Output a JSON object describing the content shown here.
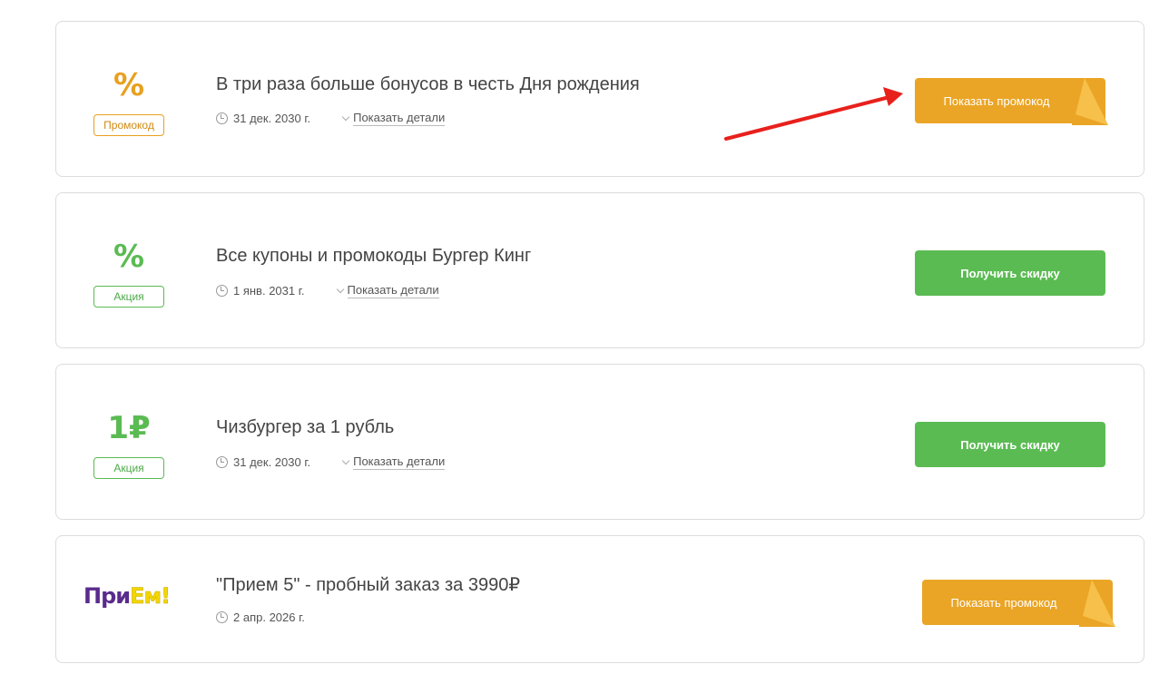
{
  "offers": [
    {
      "sign": "%",
      "tag": "Промокод",
      "title": "В три раза больше бонусов в честь Дня рождения",
      "date": "31 дек. 2030 г.",
      "details": "Показать детали",
      "button": "Показать промокод"
    },
    {
      "sign": "%",
      "tag": "Акция",
      "title": "Все купоны и промокоды Бургер Кинг",
      "date": "1 янв. 2031 г.",
      "details": "Показать детали",
      "button": "Получить скидку"
    },
    {
      "sign": "1₽",
      "tag": "Акция",
      "title": "Чизбургер за 1 рубль",
      "date": "31 дек. 2030 г.",
      "details": "Показать детали",
      "button": "Получить скидку"
    },
    {
      "logo_part1": "При",
      "logo_part2": "Ем!",
      "title": "\"Прием 5\" - пробный заказ за 3990₽",
      "date": "2 апр. 2026 г.",
      "button": "Показать промокод"
    }
  ],
  "colors": {
    "promo_orange": "#eaa526",
    "deal_green": "#5bbb53",
    "annotation_arrow": "#e8201c"
  },
  "icons": [
    "clock-icon",
    "chevron-down-icon",
    "arrow-annotation-icon"
  ]
}
